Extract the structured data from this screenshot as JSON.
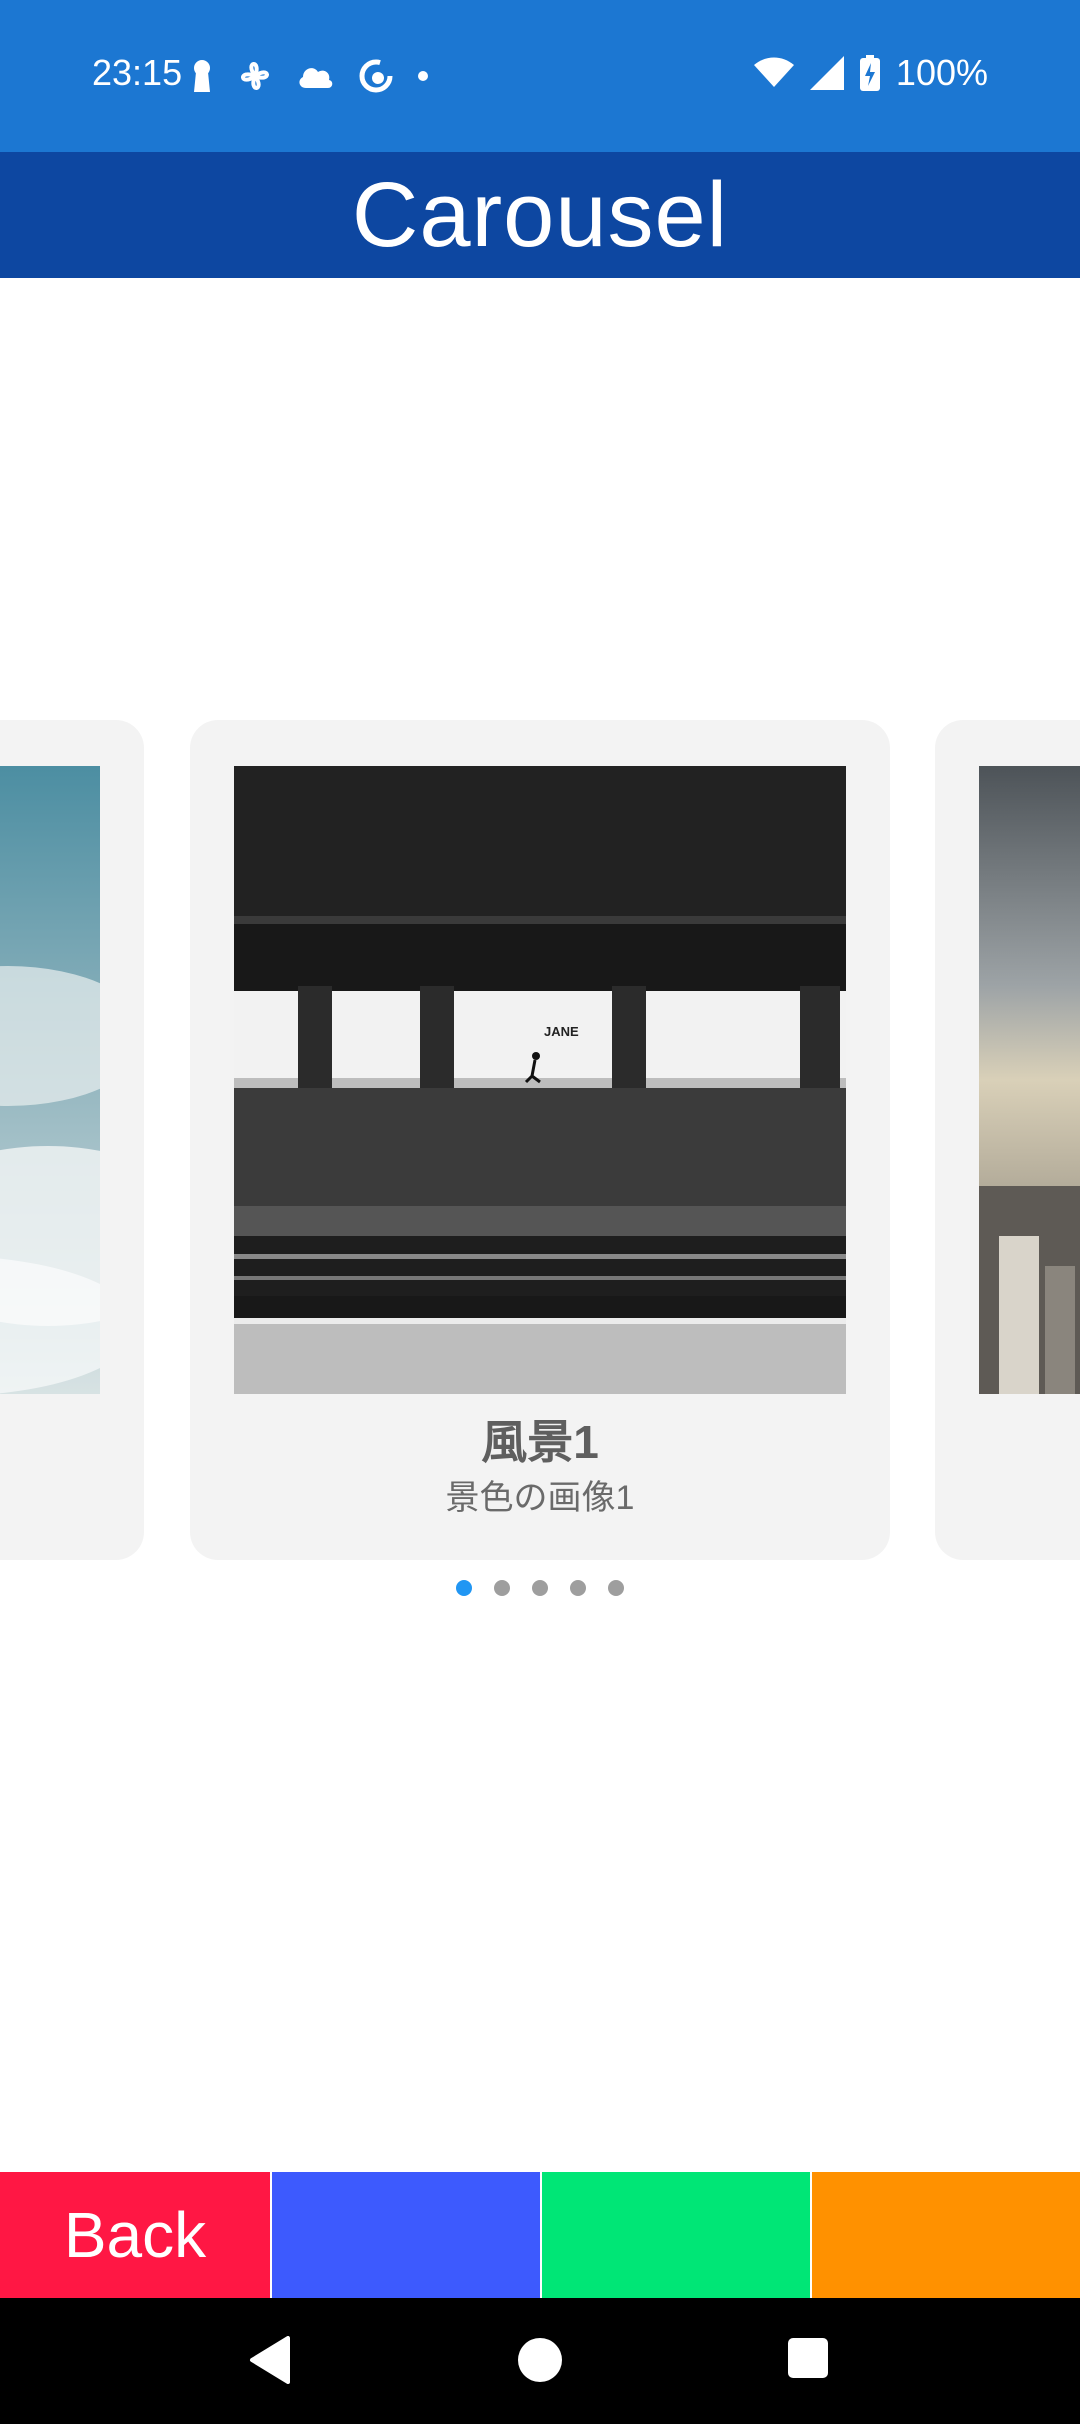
{
  "status_bar": {
    "time": "23:15",
    "battery_percent": "100%",
    "left_icons": [
      "keyhole-icon",
      "fan-icon",
      "cloud-icon",
      "sync-icon",
      "dot-icon"
    ],
    "right_icons": [
      "wifi-icon",
      "cell-signal-icon",
      "battery-charging-icon"
    ],
    "background": "#1c77d2"
  },
  "app_bar": {
    "title": "Carousel",
    "background": "#0d47a1"
  },
  "carousel": {
    "current_index": 0,
    "items": [
      {
        "title": "風景1",
        "subtitle": "景色の画像1"
      }
    ],
    "indicator_count": 5,
    "indicator_active_color": "#2196f3",
    "indicator_inactive_color": "#9e9e9e"
  },
  "bottom_bar": {
    "buttons": [
      {
        "label": "Back",
        "color": "#ff1744"
      },
      {
        "label": "",
        "color": "#3d5afe"
      },
      {
        "label": "",
        "color": "#00e676"
      },
      {
        "label": "",
        "color": "#ff9100"
      }
    ]
  },
  "nav_bar": {
    "buttons": [
      "back-triangle-icon",
      "home-circle-icon",
      "recents-square-icon"
    ]
  }
}
